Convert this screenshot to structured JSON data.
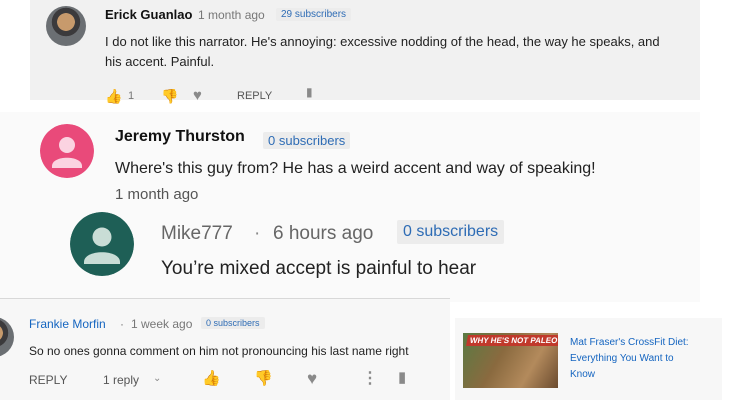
{
  "comment1": {
    "author": "Erick Guanlao",
    "time": "1 month ago",
    "subscribers": "29 subscribers",
    "text": "I do not like this narrator. He's annoying: excessive nodding of the head, the way he speaks, and his accent. Painful.",
    "likes": "1",
    "reply_label": "REPLY"
  },
  "comment2": {
    "author": "Jeremy Thurston",
    "subscribers": "0 subscribers",
    "text": "Where's this guy from? He has a weird accent and way of speaking!",
    "time": "1 month ago",
    "avatar_color": "#e94a7a"
  },
  "reply1": {
    "author": "Mike777",
    "separator": "·",
    "time": "6 hours ago",
    "subscribers": "0 subscribers",
    "text": "You’re mixed accept is painful to hear",
    "avatar_color": "#1e5f56"
  },
  "comment3": {
    "author": "Frankie Morfin",
    "separator": "·",
    "time": "1 week ago",
    "subscribers": "0 subscribers",
    "text": "So no ones gonna comment on him not pronouncing his last name right",
    "reply_label": "REPLY",
    "replies_label": "1 reply"
  },
  "recommended": {
    "title_line1": "Mat Fraser's CrossFit Diet:",
    "title_line2": "Everything You Want to",
    "title_line3": "Know",
    "thumb_text": "WHY HE'S NOT PALEO"
  },
  "colors": {
    "link": "#1565c0",
    "subs_text": "#2e6cb5"
  }
}
